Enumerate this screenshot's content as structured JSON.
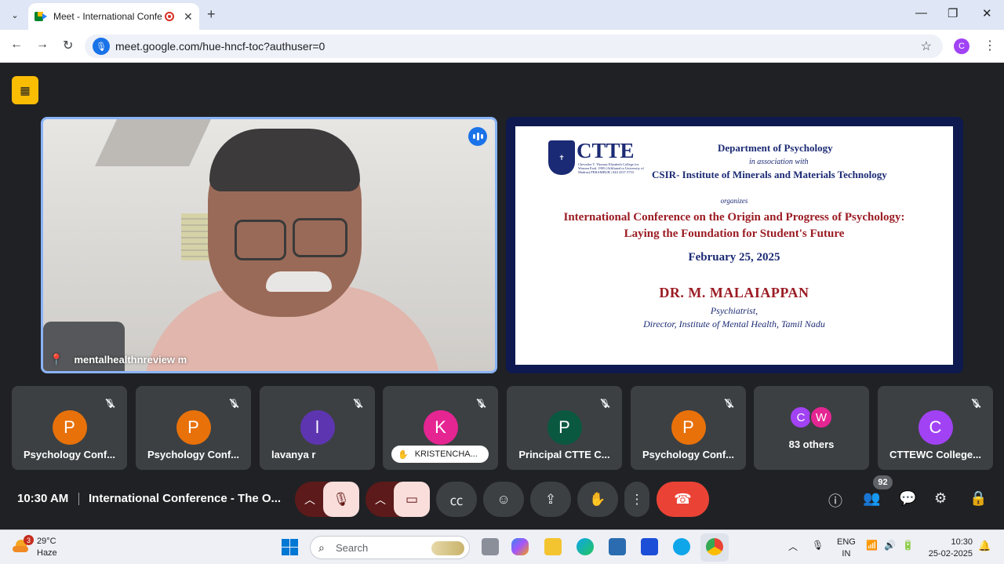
{
  "browser": {
    "tab_title": "Meet - International Confer",
    "tab_close": "✕",
    "new_tab": "+",
    "url": "meet.google.com/hue-hncf-toc?authuser=0",
    "profile_initial": "C",
    "window_controls": {
      "minimize": "—",
      "restore": "❐",
      "close": "✕"
    }
  },
  "meet": {
    "speaker": {
      "name": "mentalhealthnreview m"
    },
    "slide": {
      "logo": "CTTE",
      "logo_subtitle": "Chevalier T. Thomas Elizabeth College for Women Estd. 1995 (Affiliated to University of Madras) PERAMBUR | 044 2537 5753",
      "department": "Department of Psychology",
      "association": "in association with",
      "partner": "CSIR- Institute of Minerals and Materials Technology",
      "organizes": "organizes",
      "conference_line1": "International Conference on the Origin and Progress of Psychology:",
      "conference_line2": "Laying the Foundation for Student's Future",
      "date": "February 25, 2025",
      "speaker_name": "DR. M. MALAIAPPAN",
      "speaker_role1": "Psychiatrist,",
      "speaker_role2": "Director, Institute of Mental Health, Tamil Nadu"
    },
    "participants": [
      {
        "initial": "P",
        "name": "Psychology Conf...",
        "color": "#e8710a"
      },
      {
        "initial": "P",
        "name": "Psychology Conf...",
        "color": "#e8710a"
      },
      {
        "initial": "l",
        "name": "lavanya r",
        "color": "#5e35b1"
      },
      {
        "initial": "K",
        "name": "KRISTENCHA...",
        "color": "#e52592"
      },
      {
        "initial": "P",
        "name": "Principal CTTE C...",
        "color": "#0b5840"
      },
      {
        "initial": "P",
        "name": "Psychology Conf...",
        "color": "#e8710a"
      },
      {
        "others": [
          "C",
          "W"
        ],
        "name": "83 others",
        "colors": [
          "#a142f4",
          "#e52592"
        ]
      },
      {
        "initial": "C",
        "name": "CTTEWC College...",
        "color": "#a142f4"
      }
    ],
    "controls": {
      "time": "10:30 AM",
      "meeting_title": "International Conference - The O...",
      "people_count": "92"
    }
  },
  "taskbar": {
    "weather_badge": "3",
    "temperature": "29°C",
    "condition": "Haze",
    "search_placeholder": "Search",
    "lang1": "ENG",
    "lang2": "IN",
    "time": "10:30",
    "date": "25-02-2025"
  }
}
